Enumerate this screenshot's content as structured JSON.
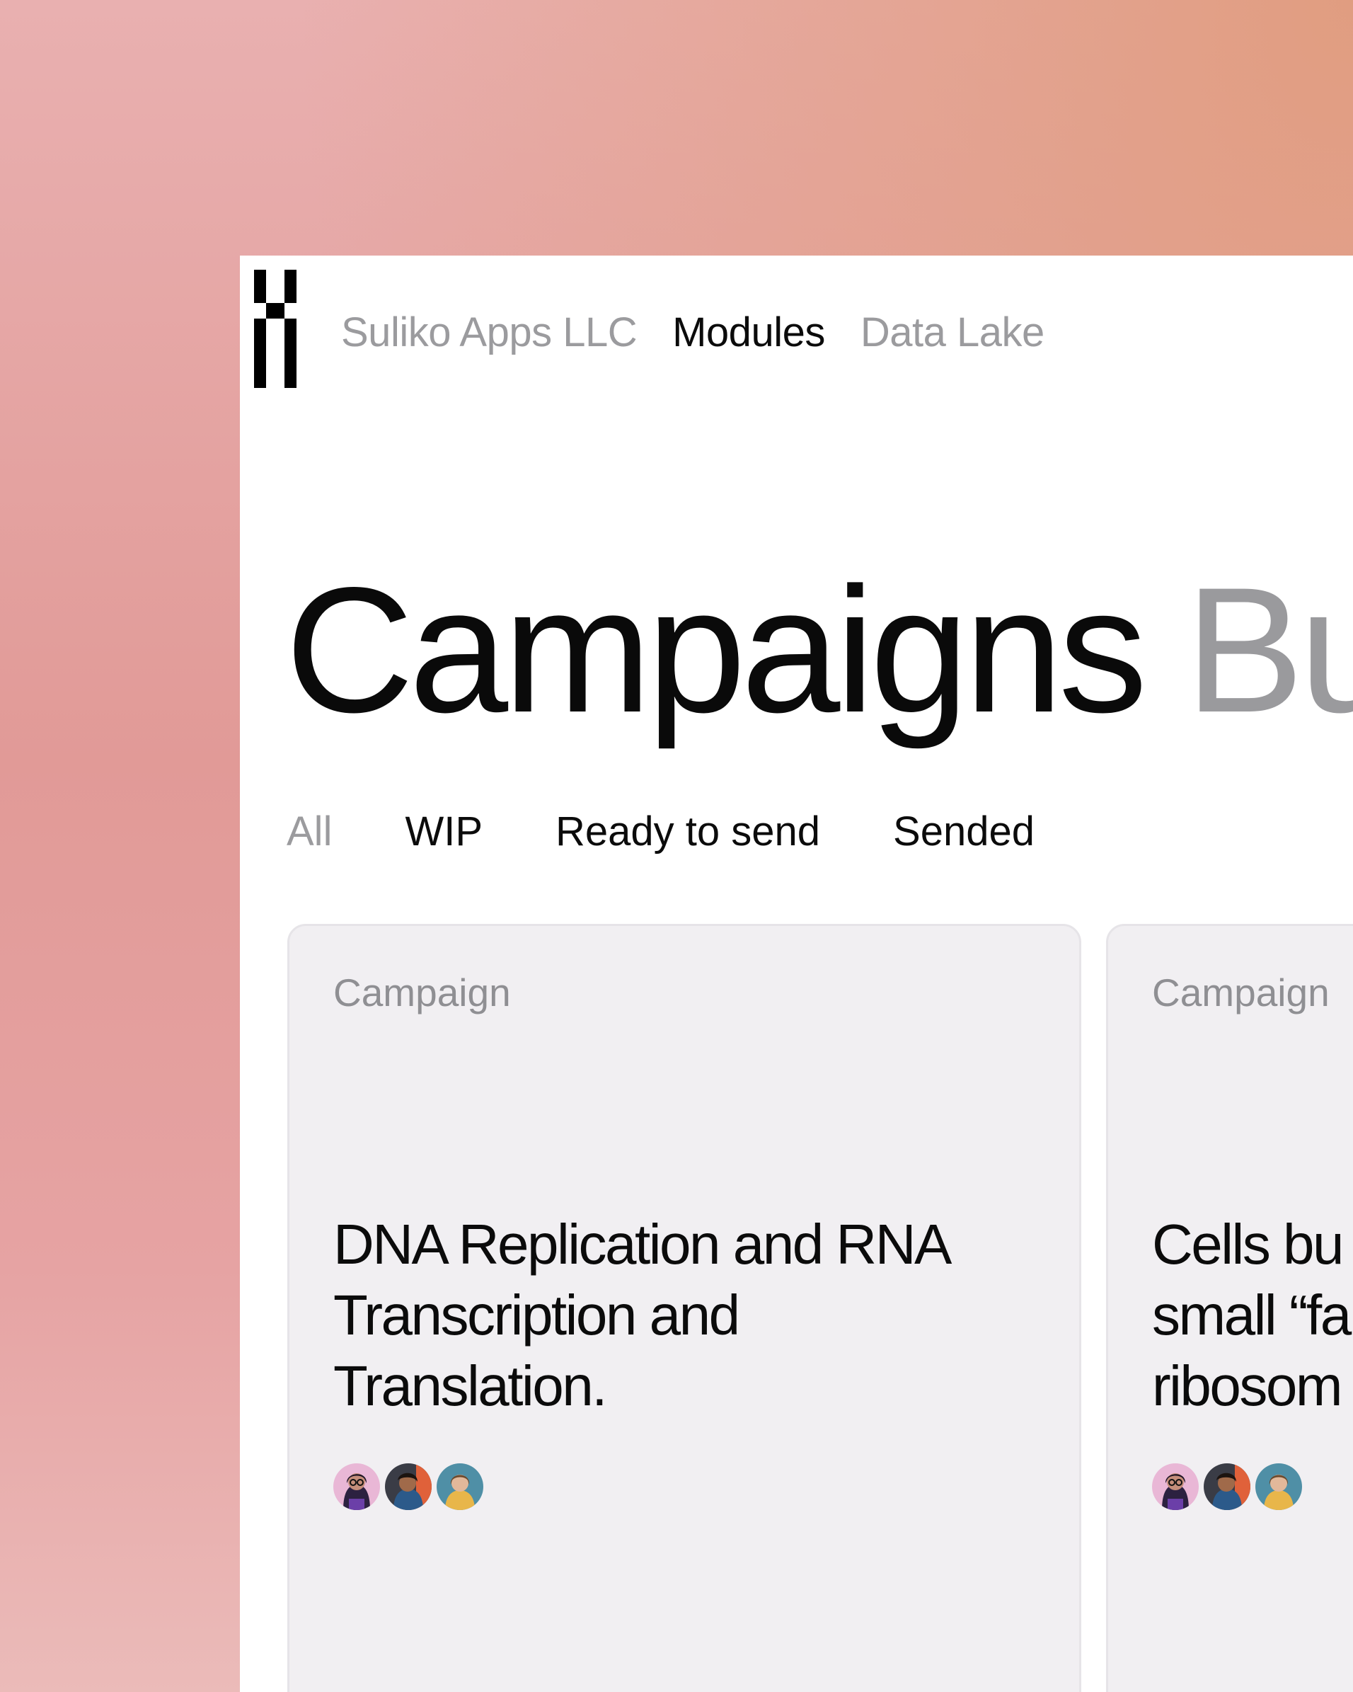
{
  "nav": {
    "logo_icon": "brand-logo",
    "links": [
      {
        "label": "Suliko Apps LLC",
        "state": "inactive"
      },
      {
        "label": "Modules",
        "state": "active"
      },
      {
        "label": "Data Lake",
        "state": "inactive"
      }
    ]
  },
  "page": {
    "title": "Campaigns",
    "title_next": "Bu"
  },
  "filters": {
    "tabs": [
      {
        "label": "All"
      },
      {
        "label": "WIP"
      },
      {
        "label": "Ready to send"
      },
      {
        "label": "Sended"
      }
    ]
  },
  "cards": [
    {
      "label": "Campaign",
      "title": "DNA Replication and RNA\nTranscription and\nTranslation.",
      "avatars": [
        "user-avatar-1",
        "user-avatar-2",
        "user-avatar-3"
      ]
    },
    {
      "label": "Campaign",
      "title": "Cells bu\nsmall “fa\nribosom",
      "avatars": [
        "user-avatar-1",
        "user-avatar-2",
        "user-avatar-3"
      ]
    }
  ],
  "colors": {
    "text_primary": "#0b0b0b",
    "text_muted": "#9b9b9e",
    "card_background": "#f1eff2",
    "background_pink": "#e19a97",
    "background_peach": "#e09c7e"
  }
}
